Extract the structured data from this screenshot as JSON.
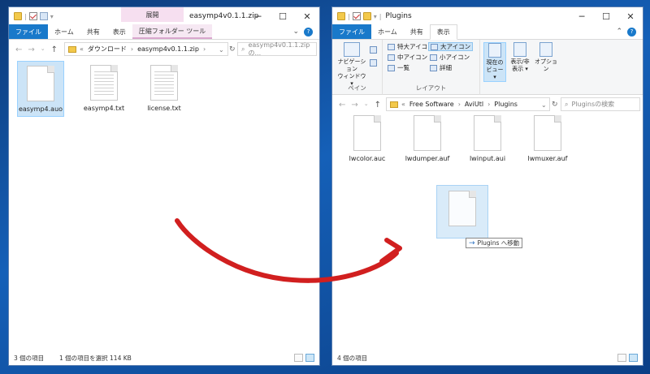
{
  "left": {
    "title": "easymp4v0.1.1.zip",
    "context_tab_header": "展開",
    "tabs": [
      "ファイル",
      "ホーム",
      "共有",
      "表示",
      "圧縮フォルダー ツール"
    ],
    "address": [
      "«",
      "ダウンロード",
      "›",
      "easymp4v0.1.1.zip",
      "›"
    ],
    "search_placeholder": "easymp4v0.1.1.zipの...",
    "files": [
      {
        "name": "easymp4.auo",
        "icon": "blank-file-icon"
      },
      {
        "name": "easymp4.txt",
        "icon": "text-file-icon"
      },
      {
        "name": "license.txt",
        "icon": "text-file-icon"
      }
    ],
    "status_count": "3 個の項目",
    "status_selection": "1 個の項目を選択  114 KB"
  },
  "right": {
    "title": "Plugins",
    "tabs": [
      "ファイル",
      "ホーム",
      "共有",
      "表示"
    ],
    "ribbon": {
      "nav_pane": "ナビゲーション\nウィンドウ ▾",
      "pane_group": "ペイン",
      "layout_items": [
        "特大アイコン",
        "大アイコン",
        "中アイコン",
        "小アイコン",
        "一覧",
        "詳細"
      ],
      "layout_group": "レイアウト",
      "current_view": "現在の\nビュー ▾",
      "show_hide": "表示/非\n表示 ▾",
      "options": "オプション"
    },
    "address": [
      "«",
      "Free Software",
      "›",
      "AviUtl",
      "›",
      "Plugins"
    ],
    "search_placeholder": "Pluginsの検索",
    "files": [
      {
        "name": "lwcolor.auc"
      },
      {
        "name": "lwdumper.auf"
      },
      {
        "name": "lwinput.aui"
      },
      {
        "name": "lwmuxer.auf"
      }
    ],
    "drag_tooltip": "Plugins へ移動",
    "status_count": "4 個の項目"
  },
  "colors": {
    "file_tab": "#1979ca",
    "context_tab": "#f6dff0",
    "arrow": "#d11f1f",
    "selection": "#cce4f7"
  }
}
